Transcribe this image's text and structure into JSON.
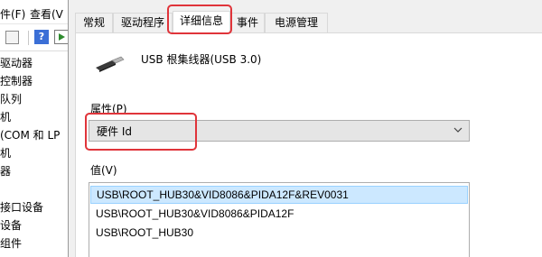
{
  "background_window": {
    "menu": [
      {
        "label": "件(F)"
      },
      {
        "label": "查看(V"
      }
    ],
    "tree_items": [
      {
        "label": "驱动器"
      },
      {
        "label": "控制器"
      },
      {
        "label": "队列"
      },
      {
        "label": "机"
      },
      {
        "label": "(COM 和 LP"
      },
      {
        "label": "机"
      },
      {
        "label": "器"
      },
      {
        "label": ""
      },
      {
        "label": "接口设备"
      },
      {
        "label": "设备"
      },
      {
        "label": "组件"
      }
    ]
  },
  "dialog": {
    "tabs": [
      {
        "label": "常规"
      },
      {
        "label": "驱动程序"
      },
      {
        "label": "详细信息"
      },
      {
        "label": "事件"
      },
      {
        "label": "电源管理"
      }
    ],
    "active_tab_index": 2,
    "device_name": "USB 根集线器(USB 3.0)",
    "property_label": "属性(P)",
    "property_value": "硬件 Id",
    "value_label": "值(V)",
    "values": [
      {
        "text": "USB\\ROOT_HUB30&VID8086&PIDA12F&REV0031",
        "selected": true
      },
      {
        "text": "USB\\ROOT_HUB30&VID8086&PIDA12F",
        "selected": false
      },
      {
        "text": "USB\\ROOT_HUB30",
        "selected": false
      }
    ]
  },
  "colors": {
    "highlight_red": "#e0343a",
    "selection_blue": "#cce8ff",
    "dialog_bg": "#f0f0f0"
  }
}
